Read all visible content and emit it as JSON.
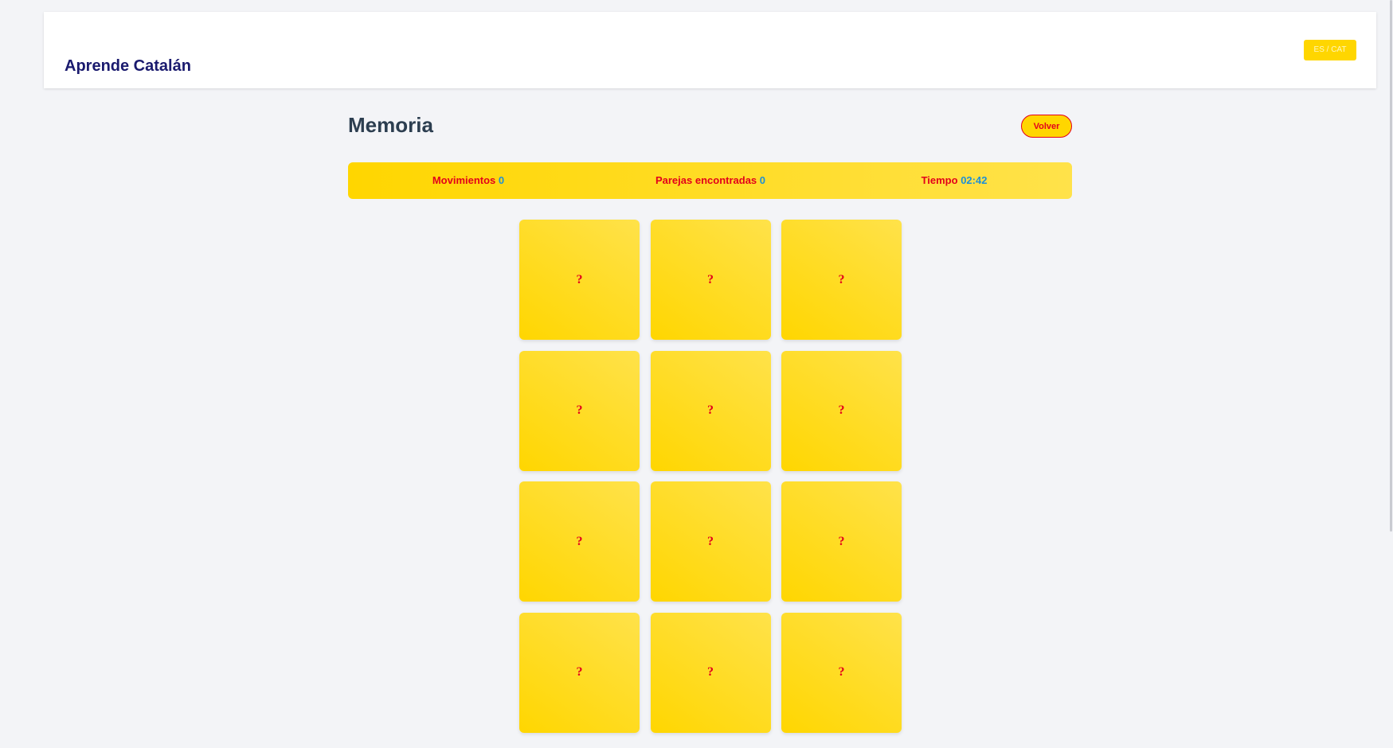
{
  "header": {
    "brand": "Aprende Catalán",
    "lang_toggle": "ES / CAT"
  },
  "page": {
    "title": "Memoria",
    "back_label": "Volver"
  },
  "stats": {
    "moves_label": "Movimientos",
    "moves_value": "0",
    "pairs_label": "Parejas encontradas",
    "pairs_value": "0",
    "time_label": "Tiempo",
    "time_value": "02:42"
  },
  "board": {
    "cards": [
      {
        "face": "?"
      },
      {
        "face": "?"
      },
      {
        "face": "?"
      },
      {
        "face": "?"
      },
      {
        "face": "?"
      },
      {
        "face": "?"
      },
      {
        "face": "?"
      },
      {
        "face": "?"
      },
      {
        "face": "?"
      },
      {
        "face": "?"
      },
      {
        "face": "?"
      },
      {
        "face": "?"
      }
    ]
  },
  "colors": {
    "accent_yellow": "#ffd600",
    "accent_red": "#e3001b",
    "value_blue": "#1e8fd6",
    "brand_navy": "#1a1a6e",
    "background": "#f3f4f7"
  }
}
